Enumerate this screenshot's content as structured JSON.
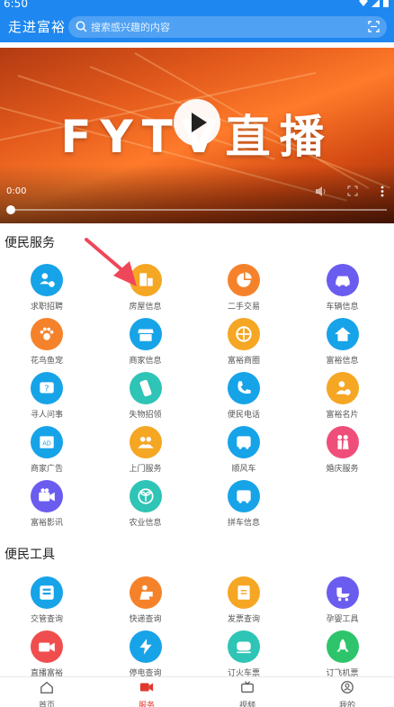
{
  "status": {
    "time": "6:50"
  },
  "header": {
    "title": "走进富裕",
    "search_placeholder": "搜索感兴趣的内容"
  },
  "player": {
    "banner_text": "FYTV直播",
    "current_time": "0:00"
  },
  "sections": [
    {
      "title": "便民服务",
      "items": [
        {
          "label": "求职招聘",
          "color": "#17a3e8",
          "icon": "person-card-icon"
        },
        {
          "label": "房屋信息",
          "color": "#f5a623",
          "icon": "building-icon"
        },
        {
          "label": "二手交易",
          "color": "#f5822a",
          "icon": "pie-chart-icon"
        },
        {
          "label": "车辆信息",
          "color": "#6b5cf0",
          "icon": "car-icon"
        },
        {
          "label": "花鸟鱼宠",
          "color": "#f5822a",
          "icon": "paw-icon"
        },
        {
          "label": "商家信息",
          "color": "#17a3e8",
          "icon": "store-icon"
        },
        {
          "label": "富裕商圈",
          "color": "#f5a623",
          "icon": "wheel-icon"
        },
        {
          "label": "富裕信息",
          "color": "#17a3e8",
          "icon": "home-icon"
        },
        {
          "label": "寻人问事",
          "color": "#17a3e8",
          "icon": "question-icon"
        },
        {
          "label": "失物招领",
          "color": "#2ec4b6",
          "icon": "phone-icon"
        },
        {
          "label": "便民电话",
          "color": "#17a3e8",
          "icon": "call-icon"
        },
        {
          "label": "富裕名片",
          "color": "#f5a623",
          "icon": "card-person-icon"
        },
        {
          "label": "商家广告",
          "color": "#17a3e8",
          "icon": "ad-icon"
        },
        {
          "label": "上门服务",
          "color": "#f5a623",
          "icon": "group-icon"
        },
        {
          "label": "顺风车",
          "color": "#17a3e8",
          "icon": "bus-icon"
        },
        {
          "label": "婚庆服务",
          "color": "#f04e7a",
          "icon": "couple-icon"
        },
        {
          "label": "富裕影讯",
          "color": "#6b5cf0",
          "icon": "camera-icon"
        },
        {
          "label": "农业信息",
          "color": "#2ec4b6",
          "icon": "sprout-icon"
        },
        {
          "label": "拼车信息",
          "color": "#17a3e8",
          "icon": "carpool-icon"
        }
      ]
    },
    {
      "title": "便民工具",
      "items": [
        {
          "label": "交管查询",
          "color": "#17a3e8",
          "icon": "traffic-icon"
        },
        {
          "label": "快递查询",
          "color": "#f5822a",
          "icon": "courier-icon"
        },
        {
          "label": "发票查询",
          "color": "#f5a623",
          "icon": "invoice-icon"
        },
        {
          "label": "孕婴工具",
          "color": "#6b5cf0",
          "icon": "stroller-icon"
        },
        {
          "label": "直播富裕",
          "color": "#f04e4e",
          "icon": "video-camera-icon"
        },
        {
          "label": "停电查询",
          "color": "#17a3e8",
          "icon": "bolt-icon"
        },
        {
          "label": "订火车票",
          "color": "#2ec4b6",
          "icon": "train-icon"
        },
        {
          "label": "订飞机票",
          "color": "#2ec46b",
          "icon": "rocket-icon"
        }
      ]
    }
  ],
  "tabbar": [
    {
      "label": "首页",
      "icon": "home-tab-icon",
      "active": false
    },
    {
      "label": "服务",
      "icon": "video-tab-icon",
      "active": true
    },
    {
      "label": "视频",
      "icon": "tv-tab-icon",
      "active": false
    },
    {
      "label": "我的",
      "icon": "profile-tab-icon",
      "active": false
    }
  ],
  "colors": {
    "header": "#1e87f0",
    "active_tab": "#e0382f",
    "arrow": "#f0465a"
  }
}
